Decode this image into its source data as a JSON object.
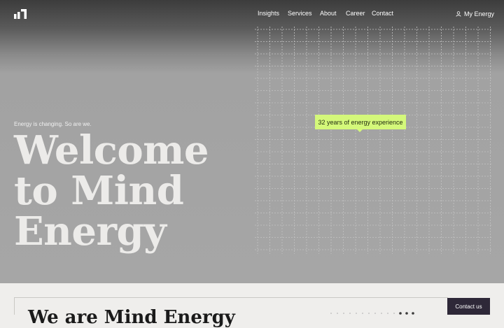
{
  "nav": {
    "items": [
      {
        "label": "Insights"
      },
      {
        "label": "Services"
      },
      {
        "label": "About"
      },
      {
        "label": "Career"
      },
      {
        "label": "Contact"
      }
    ],
    "account_label": "My Energy",
    "account_icon": "user-icon",
    "logo_icon": "mind-energy-logo"
  },
  "hero": {
    "tagline": "Energy is changing. So are we.",
    "headline": [
      "Welcome",
      "to Mind",
      "Energy"
    ],
    "badge": "32 years of energy experience"
  },
  "lower": {
    "title": "We are Mind Energy",
    "contact_button": "Contact us"
  },
  "colors": {
    "accent": "#d4f87a",
    "dark_button": "#2e2838",
    "headline": "#ecebe9"
  }
}
